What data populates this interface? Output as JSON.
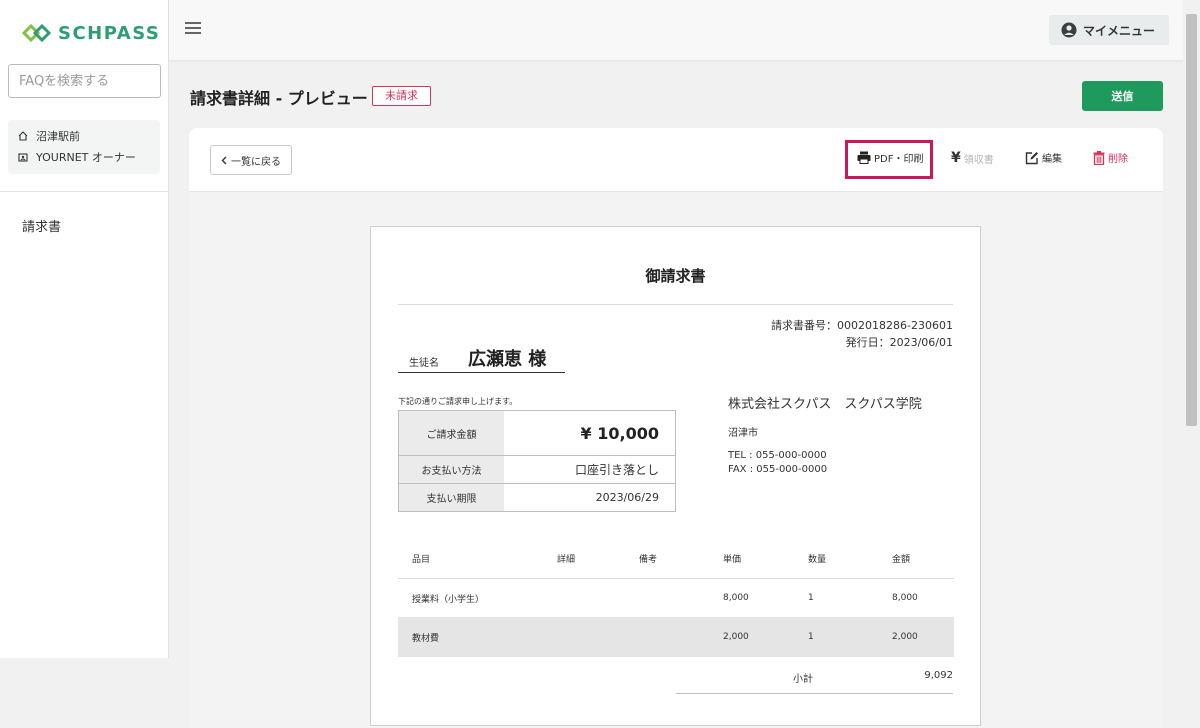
{
  "app": {
    "logo_text": "SCHPASS"
  },
  "sidebar": {
    "faq_placeholder": "FAQを検索する",
    "school": "沼津駅前",
    "owner": "YOURNET オーナー",
    "nav_invoice": "請求書"
  },
  "header": {
    "my_menu": "マイメニュー"
  },
  "page": {
    "title": "請求書詳細 - プレビュー",
    "status": "未請求",
    "send_button": "送信"
  },
  "toolbar": {
    "back": "一覧に戻る",
    "pdf_print": "PDF・印刷",
    "receipt": "領収書",
    "edit": "編集",
    "delete": "削除"
  },
  "invoice": {
    "title": "御請求書",
    "number_label": "請求書番号：",
    "number": "0002018286-230601",
    "issue_label": "発行日：",
    "issue_date": "2023/06/01",
    "student_label": "生徒名",
    "student_name": "広瀬恵 様",
    "notice": "下記の通りご請求申し上げます。",
    "summary": {
      "amount_label": "ご請求金額",
      "amount": "¥ 10,000",
      "method_label": "お支払い方法",
      "method": "口座引き落とし",
      "due_label": "支払い期限",
      "due": "2023/06/29"
    },
    "company": {
      "name": "株式会社スクパス　スクパス学院",
      "city": "沼津市",
      "tel": "TEL : 055-000-0000",
      "fax": "FAX : 055-000-0000"
    },
    "columns": [
      "品目",
      "詳細",
      "備考",
      "単価",
      "数量",
      "金額"
    ],
    "rows": [
      {
        "item": "授業料（小学生）",
        "detail": "",
        "note": "",
        "unit_price": "8,000",
        "qty": "1",
        "amount": "8,000"
      },
      {
        "item": "教材費",
        "detail": "",
        "note": "",
        "unit_price": "2,000",
        "qty": "1",
        "amount": "2,000"
      }
    ],
    "subtotal_label": "小計",
    "subtotal": "9,092"
  },
  "colors": {
    "brand_green": "#2e9e72",
    "send_green": "#1f9a5c",
    "alert_red": "#d6335a",
    "highlight_magenta": "#c8185e"
  }
}
